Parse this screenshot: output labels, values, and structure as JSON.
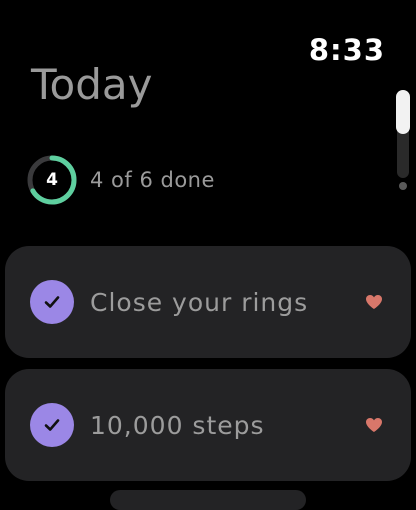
{
  "status": {
    "time": "8:33"
  },
  "header": {
    "title": "Today"
  },
  "progress": {
    "count": "4",
    "label": "4 of 6 done",
    "done": 4,
    "total": 6,
    "ring_color": "#5ecf9f"
  },
  "tasks": [
    {
      "label": "Close your rings",
      "completed": true,
      "icon": "checkmark-icon",
      "favorite_icon": "heart-icon"
    },
    {
      "label": "10,000 steps",
      "completed": true,
      "icon": "checkmark-icon",
      "favorite_icon": "heart-icon"
    }
  ],
  "colors": {
    "check_fill": "#9b87e6",
    "heart": "#d8776a",
    "card_bg": "#232325"
  }
}
